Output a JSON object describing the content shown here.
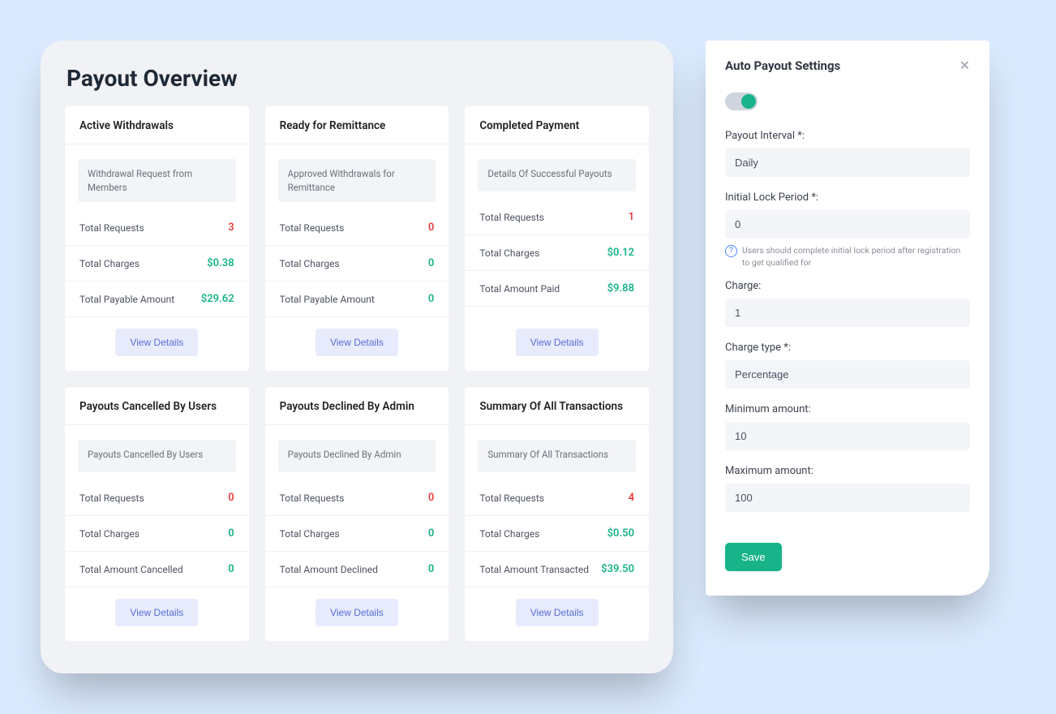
{
  "pageTitle": "Payout Overview",
  "cards": [
    {
      "title": "Active Withdrawals",
      "desc": "Withdrawal Request from Members",
      "rows": [
        {
          "label": "Total Requests",
          "value": "3",
          "cls": "val-red"
        },
        {
          "label": "Total Charges",
          "value": "$0.38",
          "cls": "val-green"
        },
        {
          "label": "Total Payable Amount",
          "value": "$29.62",
          "cls": "val-green"
        }
      ],
      "button": "View Details"
    },
    {
      "title": "Ready for Remittance",
      "desc": "Approved Withdrawals for Remittance",
      "rows": [
        {
          "label": "Total Requests",
          "value": "0",
          "cls": "val-red"
        },
        {
          "label": "Total Charges",
          "value": "0",
          "cls": "val-green"
        },
        {
          "label": "Total Payable Amount",
          "value": "0",
          "cls": "val-green"
        }
      ],
      "button": "View Details"
    },
    {
      "title": "Completed Payment",
      "desc": "Details Of Successful Payouts",
      "rows": [
        {
          "label": "Total Requests",
          "value": "1",
          "cls": "val-red"
        },
        {
          "label": "Total Charges",
          "value": "$0.12",
          "cls": "val-green"
        },
        {
          "label": "Total Amount Paid",
          "value": "$9.88",
          "cls": "val-green"
        }
      ],
      "button": "View Details"
    },
    {
      "title": "Payouts Cancelled By Users",
      "desc": "Payouts Cancelled By Users",
      "rows": [
        {
          "label": "Total Requests",
          "value": "0",
          "cls": "val-red"
        },
        {
          "label": "Total Charges",
          "value": "0",
          "cls": "val-green"
        },
        {
          "label": "Total Amount Cancelled",
          "value": "0",
          "cls": "val-green"
        }
      ],
      "button": "View Details"
    },
    {
      "title": "Payouts Declined By Admin",
      "desc": "Payouts Declined By Admin",
      "rows": [
        {
          "label": "Total Requests",
          "value": "0",
          "cls": "val-red"
        },
        {
          "label": "Total Charges",
          "value": "0",
          "cls": "val-green"
        },
        {
          "label": "Total Amount Declined",
          "value": "0",
          "cls": "val-green"
        }
      ],
      "button": "View Details"
    },
    {
      "title": "Summary Of All Transactions",
      "desc": "Summary Of All Transactions",
      "rows": [
        {
          "label": "Total Requests",
          "value": "4",
          "cls": "val-red"
        },
        {
          "label": "Total Charges",
          "value": "$0.50",
          "cls": "val-green"
        },
        {
          "label": "Total Amount Transacted",
          "value": "$39.50",
          "cls": "val-green"
        }
      ],
      "button": "View Details"
    }
  ],
  "settings": {
    "title": "Auto Payout Settings",
    "helpText": "Users should complete initial lock period after registration to get qualified for",
    "fields": {
      "interval": {
        "label": "Payout Interval *:",
        "value": "Daily"
      },
      "lock": {
        "label": "Initial Lock Period *:",
        "value": "0"
      },
      "charge": {
        "label": "Charge:",
        "value": "1"
      },
      "chargeType": {
        "label": "Charge type *:",
        "value": "Percentage"
      },
      "min": {
        "label": "Minimum amount:",
        "value": "10"
      },
      "max": {
        "label": "Maximum amount:",
        "value": "100"
      }
    },
    "saveLabel": "Save"
  }
}
